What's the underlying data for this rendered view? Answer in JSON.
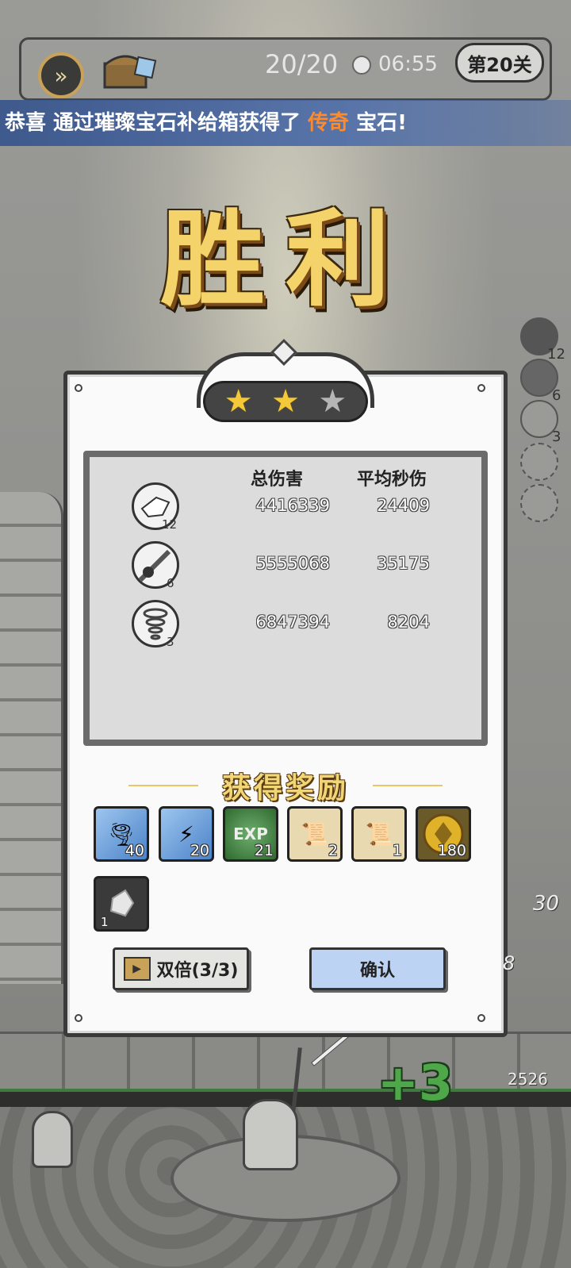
{
  "hud": {
    "wave": "20/20",
    "time": "06:55",
    "level": "第20关"
  },
  "banner": {
    "prefix": "恭喜  通过璀璨宝石补给箱获得了 ",
    "highlight": "传奇",
    "suffix": " 宝石!",
    "highlight_color": "#ff8a2a"
  },
  "result": {
    "title": "胜利",
    "stars_earned": 2,
    "stars_total": 3
  },
  "stats": {
    "col_total": "总伤害",
    "col_dps": "平均秒伤",
    "rows": [
      {
        "icon": "ice-shard-skill-icon",
        "level": "12",
        "total": "4416339",
        "dps": "24409"
      },
      {
        "icon": "meteor-skill-icon",
        "level": "6",
        "total": "5555068",
        "dps": "35175"
      },
      {
        "icon": "tornado-skill-icon",
        "level": "3",
        "total": "6847394",
        "dps": "8204"
      }
    ]
  },
  "rewards": {
    "title": "获得奖励",
    "items": [
      {
        "icon": "tornado-card-icon",
        "count": "40"
      },
      {
        "icon": "lightning-card-icon",
        "count": "20"
      },
      {
        "icon": "exp-orb-icon",
        "label": "EXP",
        "count": "21"
      },
      {
        "icon": "scroll-icon",
        "count": "2"
      },
      {
        "icon": "fire-scroll-icon",
        "count": "1"
      },
      {
        "icon": "gold-coin-icon",
        "count": "180"
      },
      {
        "icon": "gem-stone-icon",
        "count": "1"
      }
    ]
  },
  "buttons": {
    "double": "双倍(3/3)",
    "confirm": "确认"
  },
  "side_skills": [
    {
      "count": "12"
    },
    {
      "count": "6"
    },
    {
      "count": "3"
    }
  ],
  "battle": {
    "bonus": "+3",
    "hp": "2526",
    "damage_a": "30",
    "damage_b": "8"
  }
}
